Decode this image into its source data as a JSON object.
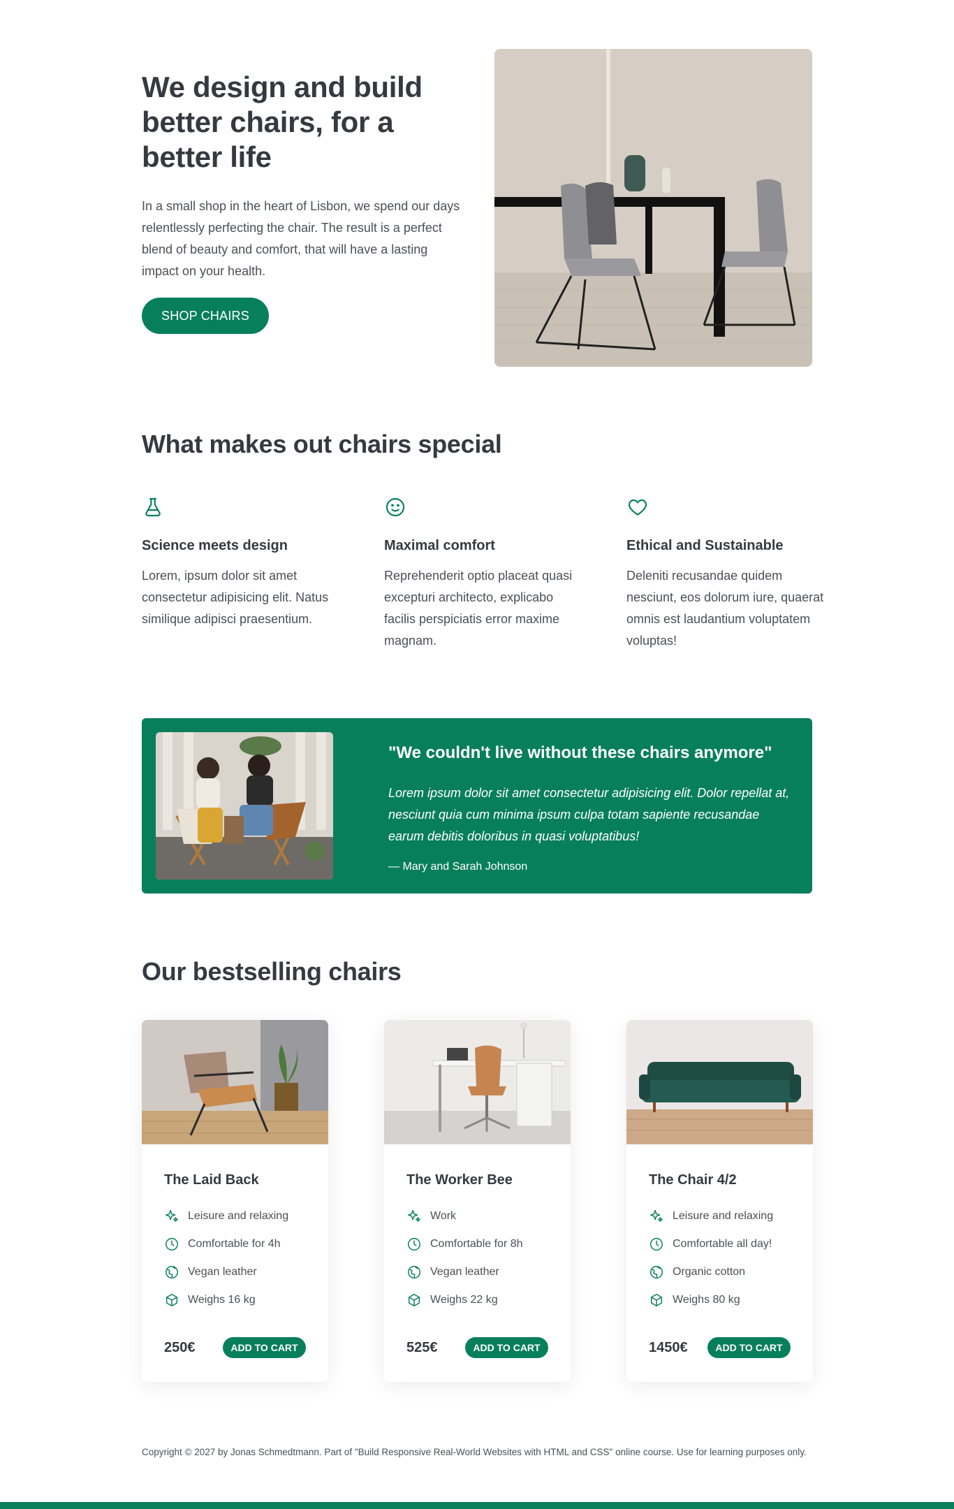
{
  "hero": {
    "title": "We design and build better chairs, for a better life",
    "text": "In a small shop in the heart of Lisbon, we spend our days relentlessly perfecting the chair. The result is a perfect blend of beauty and comfort, that will have a lasting impact on your health.",
    "button": "Shop Chairs"
  },
  "features": {
    "title": "What makes out chairs special",
    "items": [
      {
        "icon": "flask-icon",
        "title": "Science meets design",
        "text": "Lorem, ipsum dolor sit amet consectetur adipisicing elit. Natus similique adipisci praesentium."
      },
      {
        "icon": "smile-icon",
        "title": "Maximal comfort",
        "text": "Reprehenderit optio placeat quasi excepturi architecto, explicabo facilis perspiciatis error maxime magnam."
      },
      {
        "icon": "heart-icon",
        "title": "Ethical and Sustainable",
        "text": "Deleniti recusandae quidem nesciunt, eos dolorum iure, quaerat omnis est laudantium voluptatem voluptas!"
      }
    ]
  },
  "testimonial": {
    "quote": "\"We couldn't live without these chairs anymore\"",
    "text": "Lorem ipsum dolor sit amet consectetur adipisicing elit. Dolor repellat at, nesciunt quia cum minima ipsum culpa totam sapiente recusandae earum debitis doloribus in quasi voluptatibus!",
    "author": "— Mary and Sarah Johnson"
  },
  "bestsellers": {
    "title": "Our bestselling chairs",
    "cart_label": "ADD TO CART",
    "products": [
      {
        "name": "The Laid Back",
        "attrs": [
          "Leisure and relaxing",
          "Comfortable for 4h",
          "Vegan leather",
          "Weighs 16 kg"
        ],
        "price": "250€"
      },
      {
        "name": "The Worker Bee",
        "attrs": [
          "Work",
          "Comfortable for 8h",
          "Vegan leather",
          "Weighs 22 kg"
        ],
        "price": "525€"
      },
      {
        "name": "The Chair 4/2",
        "attrs": [
          "Leisure and relaxing",
          "Comfortable all day!",
          "Organic cotton",
          "Weighs 80 kg"
        ],
        "price": "1450€"
      }
    ]
  },
  "footer": {
    "text": "Copyright © 2027 by Jonas Schmedtmann. Part of \"Build Responsive Real-World Websites with HTML and CSS\" online course. Use for learning purposes only."
  },
  "colors": {
    "accent": "#087f5b",
    "text": "#343a40"
  }
}
